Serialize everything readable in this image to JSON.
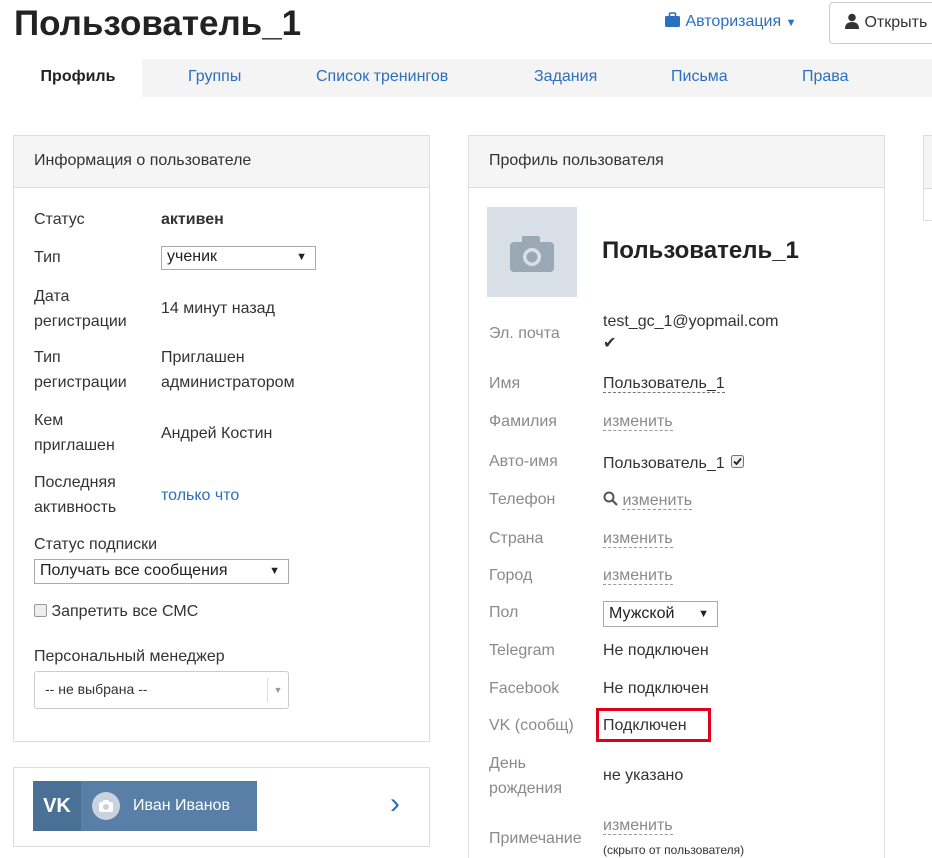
{
  "header": {
    "title": "Пользователь_1",
    "auth_label": "Авторизация",
    "open_label": "Открыть"
  },
  "tabs": [
    {
      "label": "Профиль",
      "active": true
    },
    {
      "label": "Группы"
    },
    {
      "label": "Список тренингов"
    },
    {
      "label": "Задания"
    },
    {
      "label": "Письма"
    },
    {
      "label": "Права"
    }
  ],
  "user_info": {
    "title": "Информация о пользователе",
    "status_label": "Статус",
    "status_value": "активен",
    "type_label": "Тип",
    "type_value": "ученик",
    "reg_date_label_1": "Дата",
    "reg_date_label_2": "регистрации",
    "reg_date_value": "14 минут назад",
    "reg_type_label_1": "Тип",
    "reg_type_label_2": "регистрации",
    "reg_type_value_1": "Приглашен",
    "reg_type_value_2": "администратором",
    "invited_label_1": "Кем",
    "invited_label_2": "приглашен",
    "invited_value": "Андрей Костин",
    "last_activity_label_1": "Последняя",
    "last_activity_label_2": "активность",
    "last_activity_value": "только что",
    "subscription_label": "Статус подписки",
    "subscription_value": "Получать все сообщения",
    "block_sms_label": "Запретить все СМС",
    "manager_label": "Персональный менеджер",
    "manager_value": "-- не выбрана --"
  },
  "vk_widget": {
    "logo": "VK",
    "name": "Иван Иванов",
    "chevron": "›"
  },
  "profile": {
    "title": "Профиль пользователя",
    "name": "Пользователь_1",
    "email_label": "Эл. почта",
    "email_value": "test_gc_1@yopmail.com",
    "email_check": "✔",
    "first_name_label": "Имя",
    "first_name_value": "Пользователь_1",
    "last_name_label": "Фамилия",
    "last_name_value": "изменить",
    "auto_name_label": "Авто-имя",
    "auto_name_value": "Пользователь_1",
    "phone_label": "Телефон",
    "phone_value": "изменить",
    "country_label": "Страна",
    "country_value": "изменить",
    "city_label": "Город",
    "city_value": "изменить",
    "gender_label": "Пол",
    "gender_value": "Мужской",
    "telegram_label": "Telegram",
    "telegram_value": "Не подключен",
    "facebook_label": "Facebook",
    "facebook_value": "Не подключен",
    "vk_label": "VK (сообщ)",
    "vk_value": "Подключен",
    "birthday_label_1": "День",
    "birthday_label_2": "рождения",
    "birthday_value": "не указано",
    "note_label": "Примечание",
    "note_value": "изменить",
    "note_hint": "(скрыто от пользователя)"
  },
  "colors": {
    "link": "#2a6fc0",
    "highlight": "#e0001b",
    "vk": "#5a7fa6"
  }
}
